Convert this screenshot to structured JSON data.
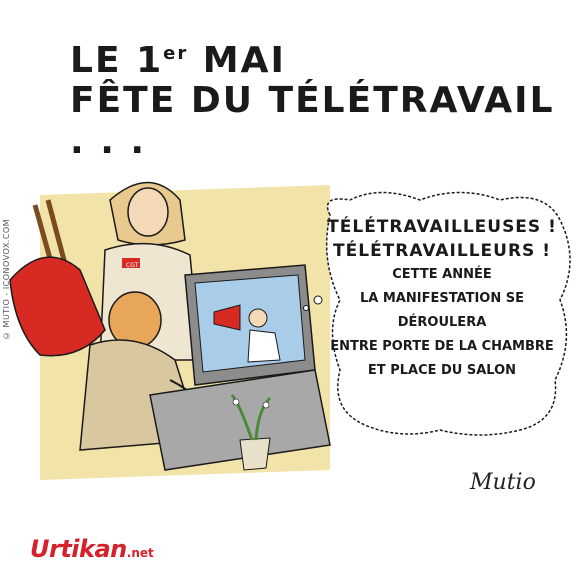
{
  "title": {
    "line1_prefix": "LE 1",
    "line1_sup": "er",
    "line1_suffix": " MAI",
    "line2": "FÊTE DU TÉLÉTRAVAIL . . ."
  },
  "credit": "© MUTIO - ICONOVOX.COM",
  "bubble": {
    "line1": "TÉLÉTRAVAILLEUSES !",
    "line2": "TÉLÉTRAVAILLEURS !",
    "line3": "CETTE ANNÉE",
    "line4": "LA MANIFESTATION SE DÉROULERA",
    "line5": "ENTRE PORTE DE LA CHAMBRE",
    "line6": "ET PLACE DU SALON"
  },
  "badge": "CGT",
  "signature": "Mutio",
  "logo": {
    "name": "Urtikan",
    "tld": ".net"
  },
  "colors": {
    "wall": "#f2e3a8",
    "flag": "#d62a23",
    "ink": "#1a1a1a",
    "logo": "#d6202a",
    "screen": "#a9cde8"
  }
}
